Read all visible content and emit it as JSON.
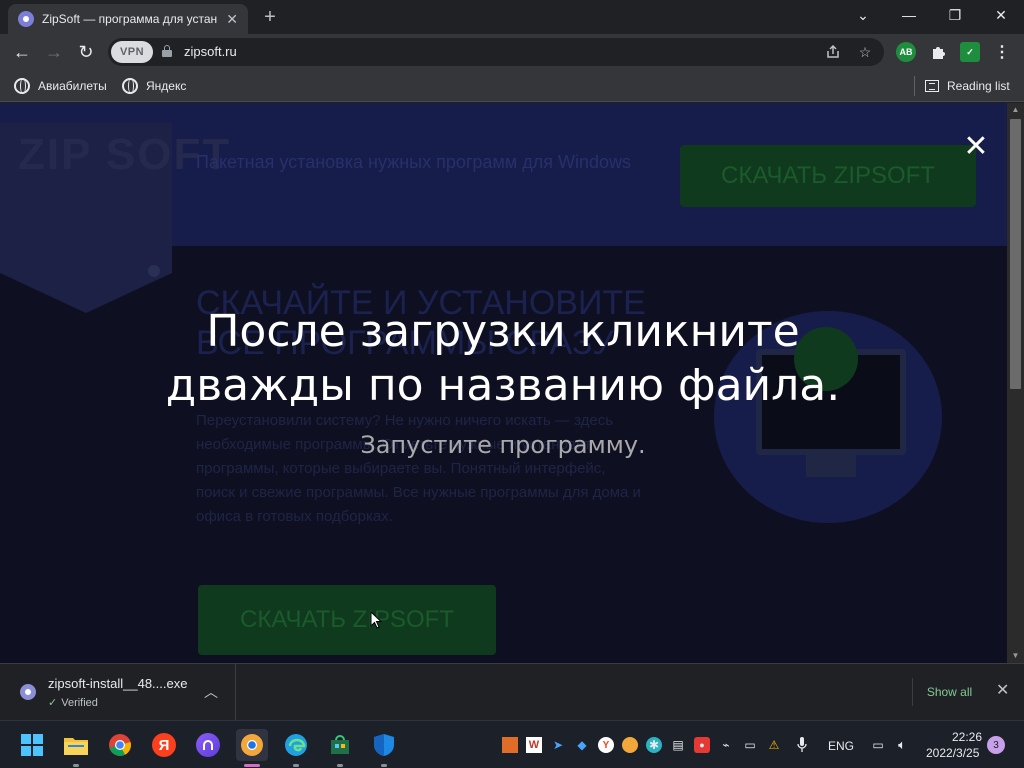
{
  "browser": {
    "tab": {
      "title": "ZipSoft — программа для устан",
      "close": "✕"
    },
    "new_tab": "+",
    "window_controls": {
      "list_tabs": "⌄",
      "minimize": "—",
      "restore": "❐",
      "close": "✕"
    },
    "nav": {
      "back": "←",
      "forward": "→",
      "reload": "↻"
    },
    "omnibox": {
      "vpn": "VPN",
      "url": "zipsoft.ru"
    },
    "extensions": {
      "ab_label": "AB"
    },
    "bookmarks": [
      {
        "label": "Авиабилеты"
      },
      {
        "label": "Яндекс"
      }
    ],
    "reading_list": "Reading list"
  },
  "page": {
    "logo": "ZIP SOFT",
    "header_tagline": "Пакетная установка нужных программ для Windows",
    "header_download": "СКАЧАТЬ ZIPSOFT",
    "hero_title": "СКАЧАЙТЕ И УСТАНОВИТЕ ВСЕ ПРОГРАММЫ СРАЗУ",
    "hero_desc": "Переустановили систему? Не нужно ничего искать — здесь необходимые программы. Отметьте нужные и установит программы, которые выбираете вы. Понятный интерфейс, поиск и свежие программы. Все нужные программы для дома и офиса в готовых подборках.",
    "hero_download": "СКАЧАТЬ ZIPSOFT"
  },
  "overlay": {
    "close": "✕",
    "main_line1": "После загрузки кликните",
    "main_line2": "дважды по названию файла.",
    "sub": "Запустите программу."
  },
  "download_shelf": {
    "file_name": "zipsoft-install__48....exe",
    "status": "Verified",
    "show_all": "Show all",
    "close": "✕"
  },
  "taskbar": {
    "language": "ENG",
    "time": "22:26",
    "date": "2022/3/25",
    "notifications": "3"
  },
  "colors": {
    "overlay_bg": "#0e1022",
    "download_green": "#81c995",
    "active_indicator": "#d46ec4"
  }
}
